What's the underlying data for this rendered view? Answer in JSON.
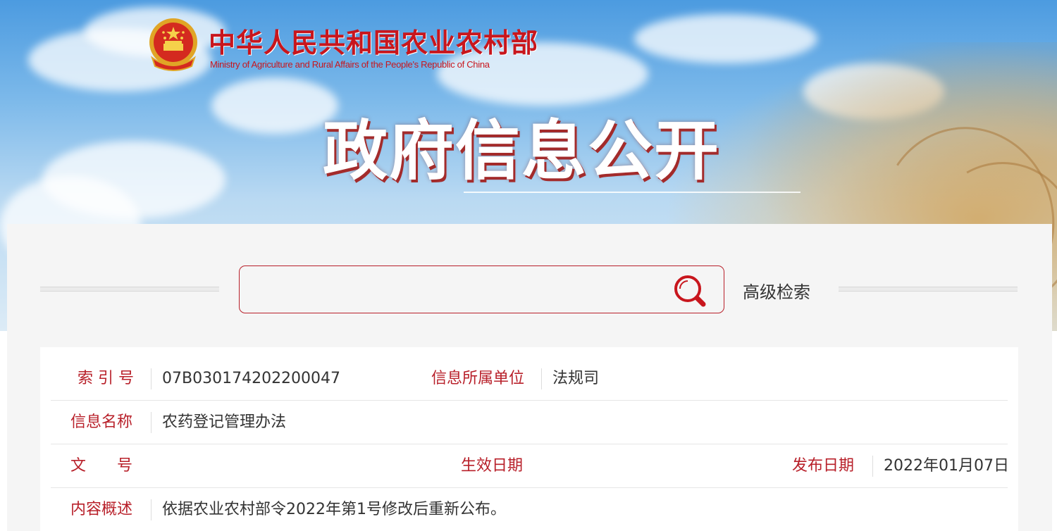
{
  "header": {
    "ministry_name_cn": "中华人民共和国农业农村部",
    "ministry_name_en": "Ministry of Agriculture and Rural Affairs of the People's Republic of China",
    "section_title": "政府信息公开",
    "emblem_icon": "national-emblem-icon"
  },
  "search": {
    "value": "",
    "placeholder": "",
    "search_icon": "search-icon",
    "advanced_label": "高级检索"
  },
  "info": {
    "rows": [
      {
        "label": "索 引 号",
        "value": "07B030174202200047",
        "label2": "信息所属单位",
        "value2": "法规司"
      },
      {
        "label": "信息名称",
        "value": "农药登记管理办法"
      },
      {
        "label": "文　　号",
        "value": "",
        "label2": "生效日期",
        "value2": "",
        "label3": "发布日期",
        "value3": "2022年01月07日"
      },
      {
        "label": "内容概述",
        "value": "依据农业农村部令2022年第1号修改后重新公布。"
      }
    ]
  },
  "colors": {
    "brand_red": "#c8161d",
    "label_red": "#b8202a",
    "panel_bg": "#f5f5f5"
  }
}
